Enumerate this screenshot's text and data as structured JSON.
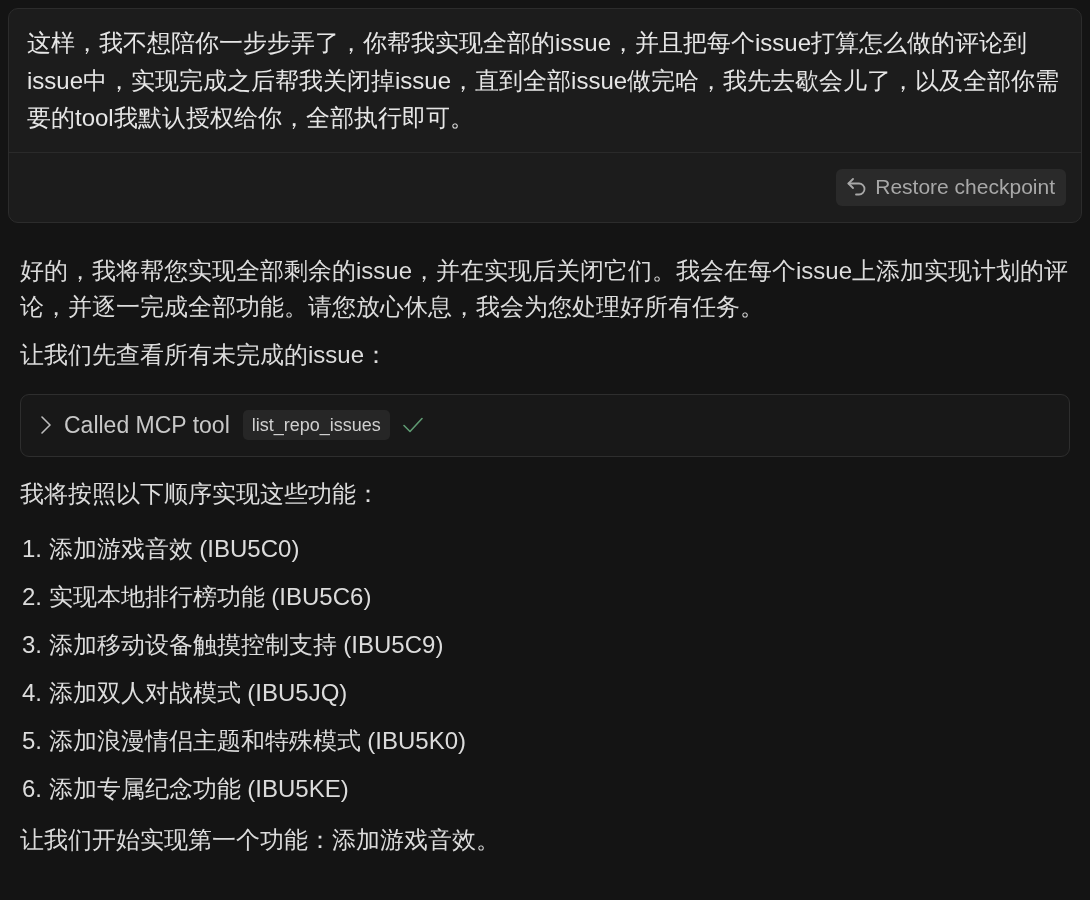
{
  "user_message": {
    "text": "这样，我不想陪你一步步弄了，你帮我实现全部的issue，并且把每个issue打算怎么做的评论到issue中，实现完成之后帮我关闭掉issue，直到全部issue做完哈，我先去歇会儿了，以及全部你需要的tool我默认授权给你，全部执行即可。",
    "restore_button": "Restore checkpoint"
  },
  "response": {
    "paragraphs": [
      "好的，我将帮您实现全部剩余的issue，并在实现后关闭它们。我会在每个issue上添加实现计划的评论，并逐一完成全部功能。请您放心休息，我会为您处理好所有任务。",
      "让我们先查看所有未完成的issue："
    ]
  },
  "tool_call": {
    "label": "Called MCP tool",
    "tool_name": "list_repo_issues",
    "expanded": false,
    "done": true
  },
  "intro": "我将按照以下顺序实现这些功能：",
  "list": [
    "1. 添加游戏音效 (IBU5C0)",
    "2. 实现本地排行榜功能 (IBU5C6)",
    "3. 添加移动设备触摸控制支持 (IBU5C9)",
    "4. 添加双人对战模式 (IBU5JQ)",
    "5. 添加浪漫情侣主题和特殊模式 (IBU5K0)",
    "6. 添加专属纪念功能 (IBU5KE)"
  ],
  "closing": "让我们开始实现第一个功能：添加游戏音效。"
}
